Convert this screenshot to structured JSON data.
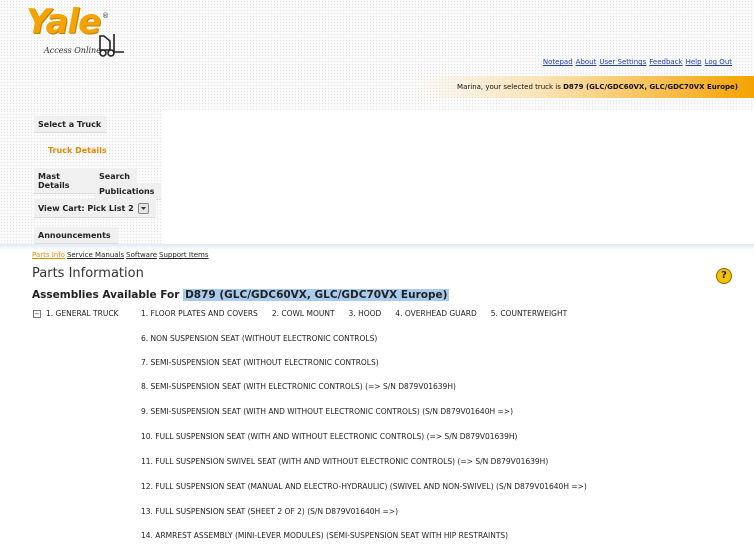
{
  "logo": {
    "brand": "Yale",
    "registered": "®",
    "tagline": "Access Online"
  },
  "top_links": [
    "Notepad",
    "About",
    "User Settings",
    "Feedback",
    "Help",
    "Log Out"
  ],
  "truck_bar": {
    "prefix": "Marina, your selected truck is ",
    "truck": "D879 (GLC/GDC60VX, GLC/GDC70VX Europe)"
  },
  "left_nav": {
    "select_truck": "Select a Truck",
    "truck_details": "Truck Details",
    "mast_details": "Mast Details",
    "search": "Search",
    "publications": "Publications",
    "view_cart": "View Cart: Pick List 2",
    "announcements": "Announcements"
  },
  "sub_tabs": [
    "Parts Info",
    "Service Manuals",
    "Software",
    "Support Items"
  ],
  "page": {
    "title": "Parts Information",
    "assemblies_prefix": "Assemblies Available For",
    "assemblies_truck": "D879 (GLC/GDC60VX, GLC/GDC70VX Europe)",
    "help": "?"
  },
  "tree": {
    "expander": "⊟",
    "group": "1. GENERAL TRUCK",
    "row1": [
      "1. FLOOR PLATES AND COVERS",
      "2. COWL MOUNT",
      "3. HOOD",
      "4. OVERHEAD GUARD",
      "5. COUNTERWEIGHT"
    ],
    "items": [
      "6. NON SUSPENSION SEAT (WITHOUT ELECTRONIC CONTROLS)",
      "7. SEMI-SUSPENSION SEAT (WITHOUT ELECTRONIC CONTROLS)",
      "8. SEMI-SUSPENSION SEAT (WITH ELECTRONIC CONTROLS) (=> S/N D879V01639H)",
      "9. SEMI-SUSPENSION SEAT (WITH AND WITHOUT ELECTRONIC CONTROLS) (S/N D879V01640H =>)",
      "10. FULL SUSPENSION SEAT (WITH AND WITHOUT ELECTRONIC CONTROLS) (=> S/N D879V01639H)",
      "11. FULL SUSPENSION SWIVEL SEAT (WITH AND WITHOUT ELECTRONIC CONTROLS) (=> S/N D879V01639H)",
      "12. FULL SUSPENSION SEAT (MANUAL AND ELECTRO-HYDRAULIC) (SWIVEL AND NON-SWIVEL) (S/N D879V01640H =>)",
      "13. FULL SUSPENSION SEAT (SHEET 2 OF 2) (S/N D879V01640H =>)",
      "14. ARMREST ASSEMBLY (MINI-LEVER MODULES) (SEMI-SUSPENSION SEAT WITH HIP RESTRAINTS)"
    ]
  },
  "colors": {
    "brand": "#f5a300",
    "link": "#1a3fb0",
    "highlight": "#a9cbee",
    "active_tab": "#e08a00"
  }
}
